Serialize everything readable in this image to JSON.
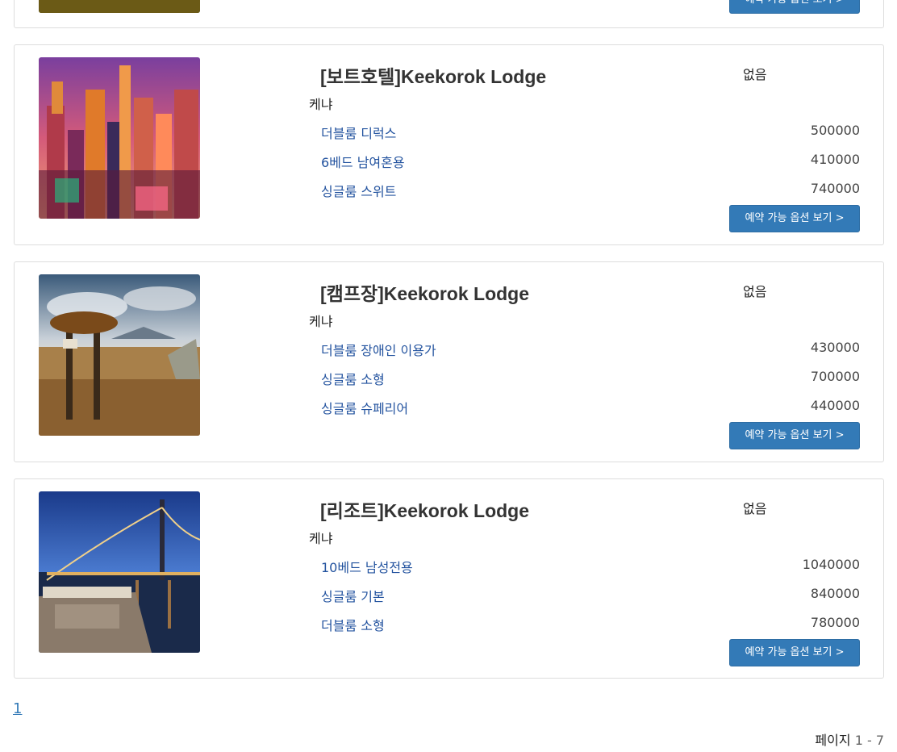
{
  "colors": {
    "primary_button": "#337ab7",
    "room_link": "#23539f",
    "card_border": "#dddddd"
  },
  "listing": [
    {
      "title": "",
      "status": "",
      "region": "",
      "rooms": [],
      "button_label": "예약 가능 옵션 보기 >"
    },
    {
      "title": "[보트호텔]Keekorok Lodge",
      "status": "없음",
      "region": "케냐",
      "image": "city-skyline-photo",
      "rooms": [
        {
          "name": "더블룸 디럭스",
          "price": "500000"
        },
        {
          "name": "6베드 남여혼용",
          "price": "410000"
        },
        {
          "name": "싱글룸 스위트",
          "price": "740000"
        }
      ],
      "button_label": "예약 가능 옵션 보기 >"
    },
    {
      "title": "[캠프장]Keekorok Lodge",
      "status": "없음",
      "region": "케냐",
      "image": "desert-signpost-photo",
      "rooms": [
        {
          "name": "더블룸 장애인 이용가",
          "price": "430000"
        },
        {
          "name": "싱글룸 소형",
          "price": "700000"
        },
        {
          "name": "싱글룸 슈페리어",
          "price": "440000"
        }
      ],
      "button_label": "예약 가능 옵션 보기 >"
    },
    {
      "title": "[리조트]Keekorok Lodge",
      "status": "없음",
      "region": "케냐",
      "image": "bay-bridge-night-photo",
      "rooms": [
        {
          "name": "10베드 남성전용",
          "price": "1040000"
        },
        {
          "name": "싱글룸 기본",
          "price": "840000"
        },
        {
          "name": "더블룸 소형",
          "price": "780000"
        }
      ],
      "button_label": "예약 가능 옵션 보기 >"
    }
  ],
  "pagination": {
    "current_page": "1",
    "info_label": "페이지",
    "info_range": "1 - 7"
  }
}
